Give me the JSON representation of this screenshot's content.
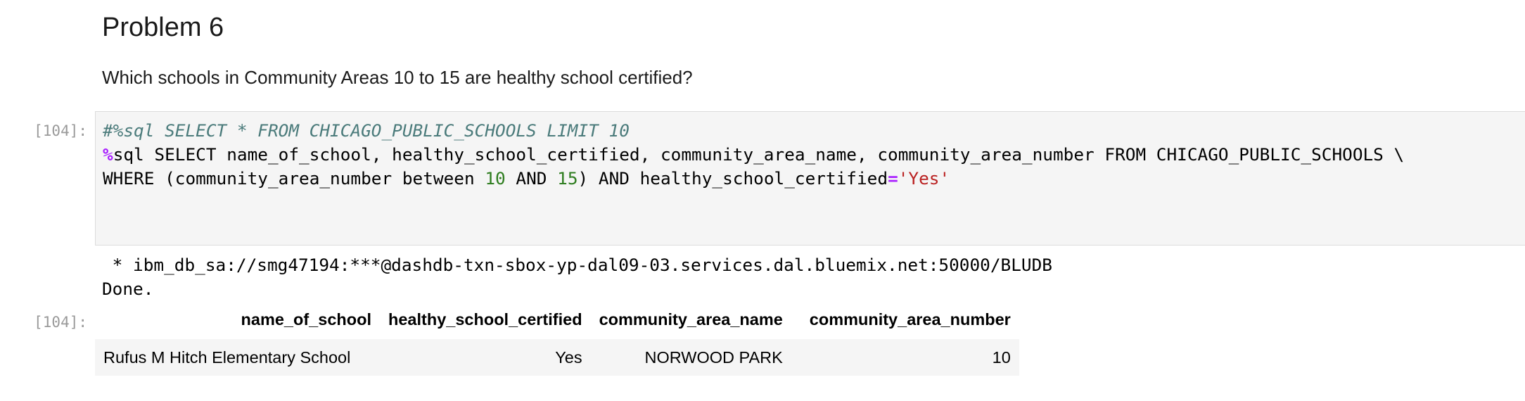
{
  "markdown": {
    "heading": "Problem 6",
    "question": "Which schools in Community Areas 10 to 15 are healthy school certified?"
  },
  "code_cell": {
    "prompt": "[104]:",
    "line1_comment": "#%sql SELECT * FROM CHICAGO_PUBLIC_SCHOOLS LIMIT 10",
    "line2_magic": "%",
    "line2_rest": "sql SELECT name_of_school, healthy_school_certified, community_area_name, community_area_number FROM CHICAGO_PUBLIC_SCHOOLS \\",
    "line3_part1": "WHERE (community_area_number between ",
    "line3_num1": "10",
    "line3_and": " AND ",
    "line3_num2": "15",
    "line3_part2": ") AND healthy_school_certified",
    "line3_op": "=",
    "line3_str": "'Yes'"
  },
  "output": {
    "stdout_line1": " * ibm_db_sa://smg47194:***@dashdb-txn-sbox-yp-dal09-03.services.dal.bluemix.net:50000/BLUDB",
    "stdout_line2": "Done.",
    "prompt": "[104]:",
    "table": {
      "columns": [
        "name_of_school",
        "healthy_school_certified",
        "community_area_name",
        "community_area_number"
      ],
      "rows": [
        [
          "Rufus M Hitch Elementary School",
          "Yes",
          "NORWOOD PARK",
          "10"
        ]
      ]
    }
  }
}
